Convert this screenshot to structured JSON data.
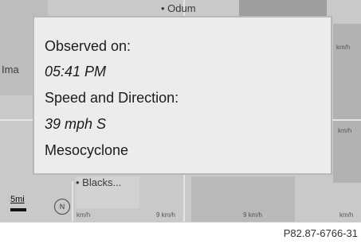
{
  "popup": {
    "observed_label": "Observed on:",
    "observed_time": "05:41 PM",
    "speed_label": "Speed and Direction:",
    "speed_value": "39 mph S",
    "event_type": "Mesocyclone"
  },
  "map": {
    "places": [
      "Odum",
      "Ima",
      "Blacks..."
    ],
    "speed_labels": [
      "km/h",
      "km/h",
      "km/h",
      "km/h",
      "9 km/h",
      "9 km/h"
    ],
    "scale_value": "5mi",
    "compass_label": "N",
    "compass_icon": "compass-icon"
  },
  "footer": {
    "figure_code": "P82.87-6766-31"
  }
}
